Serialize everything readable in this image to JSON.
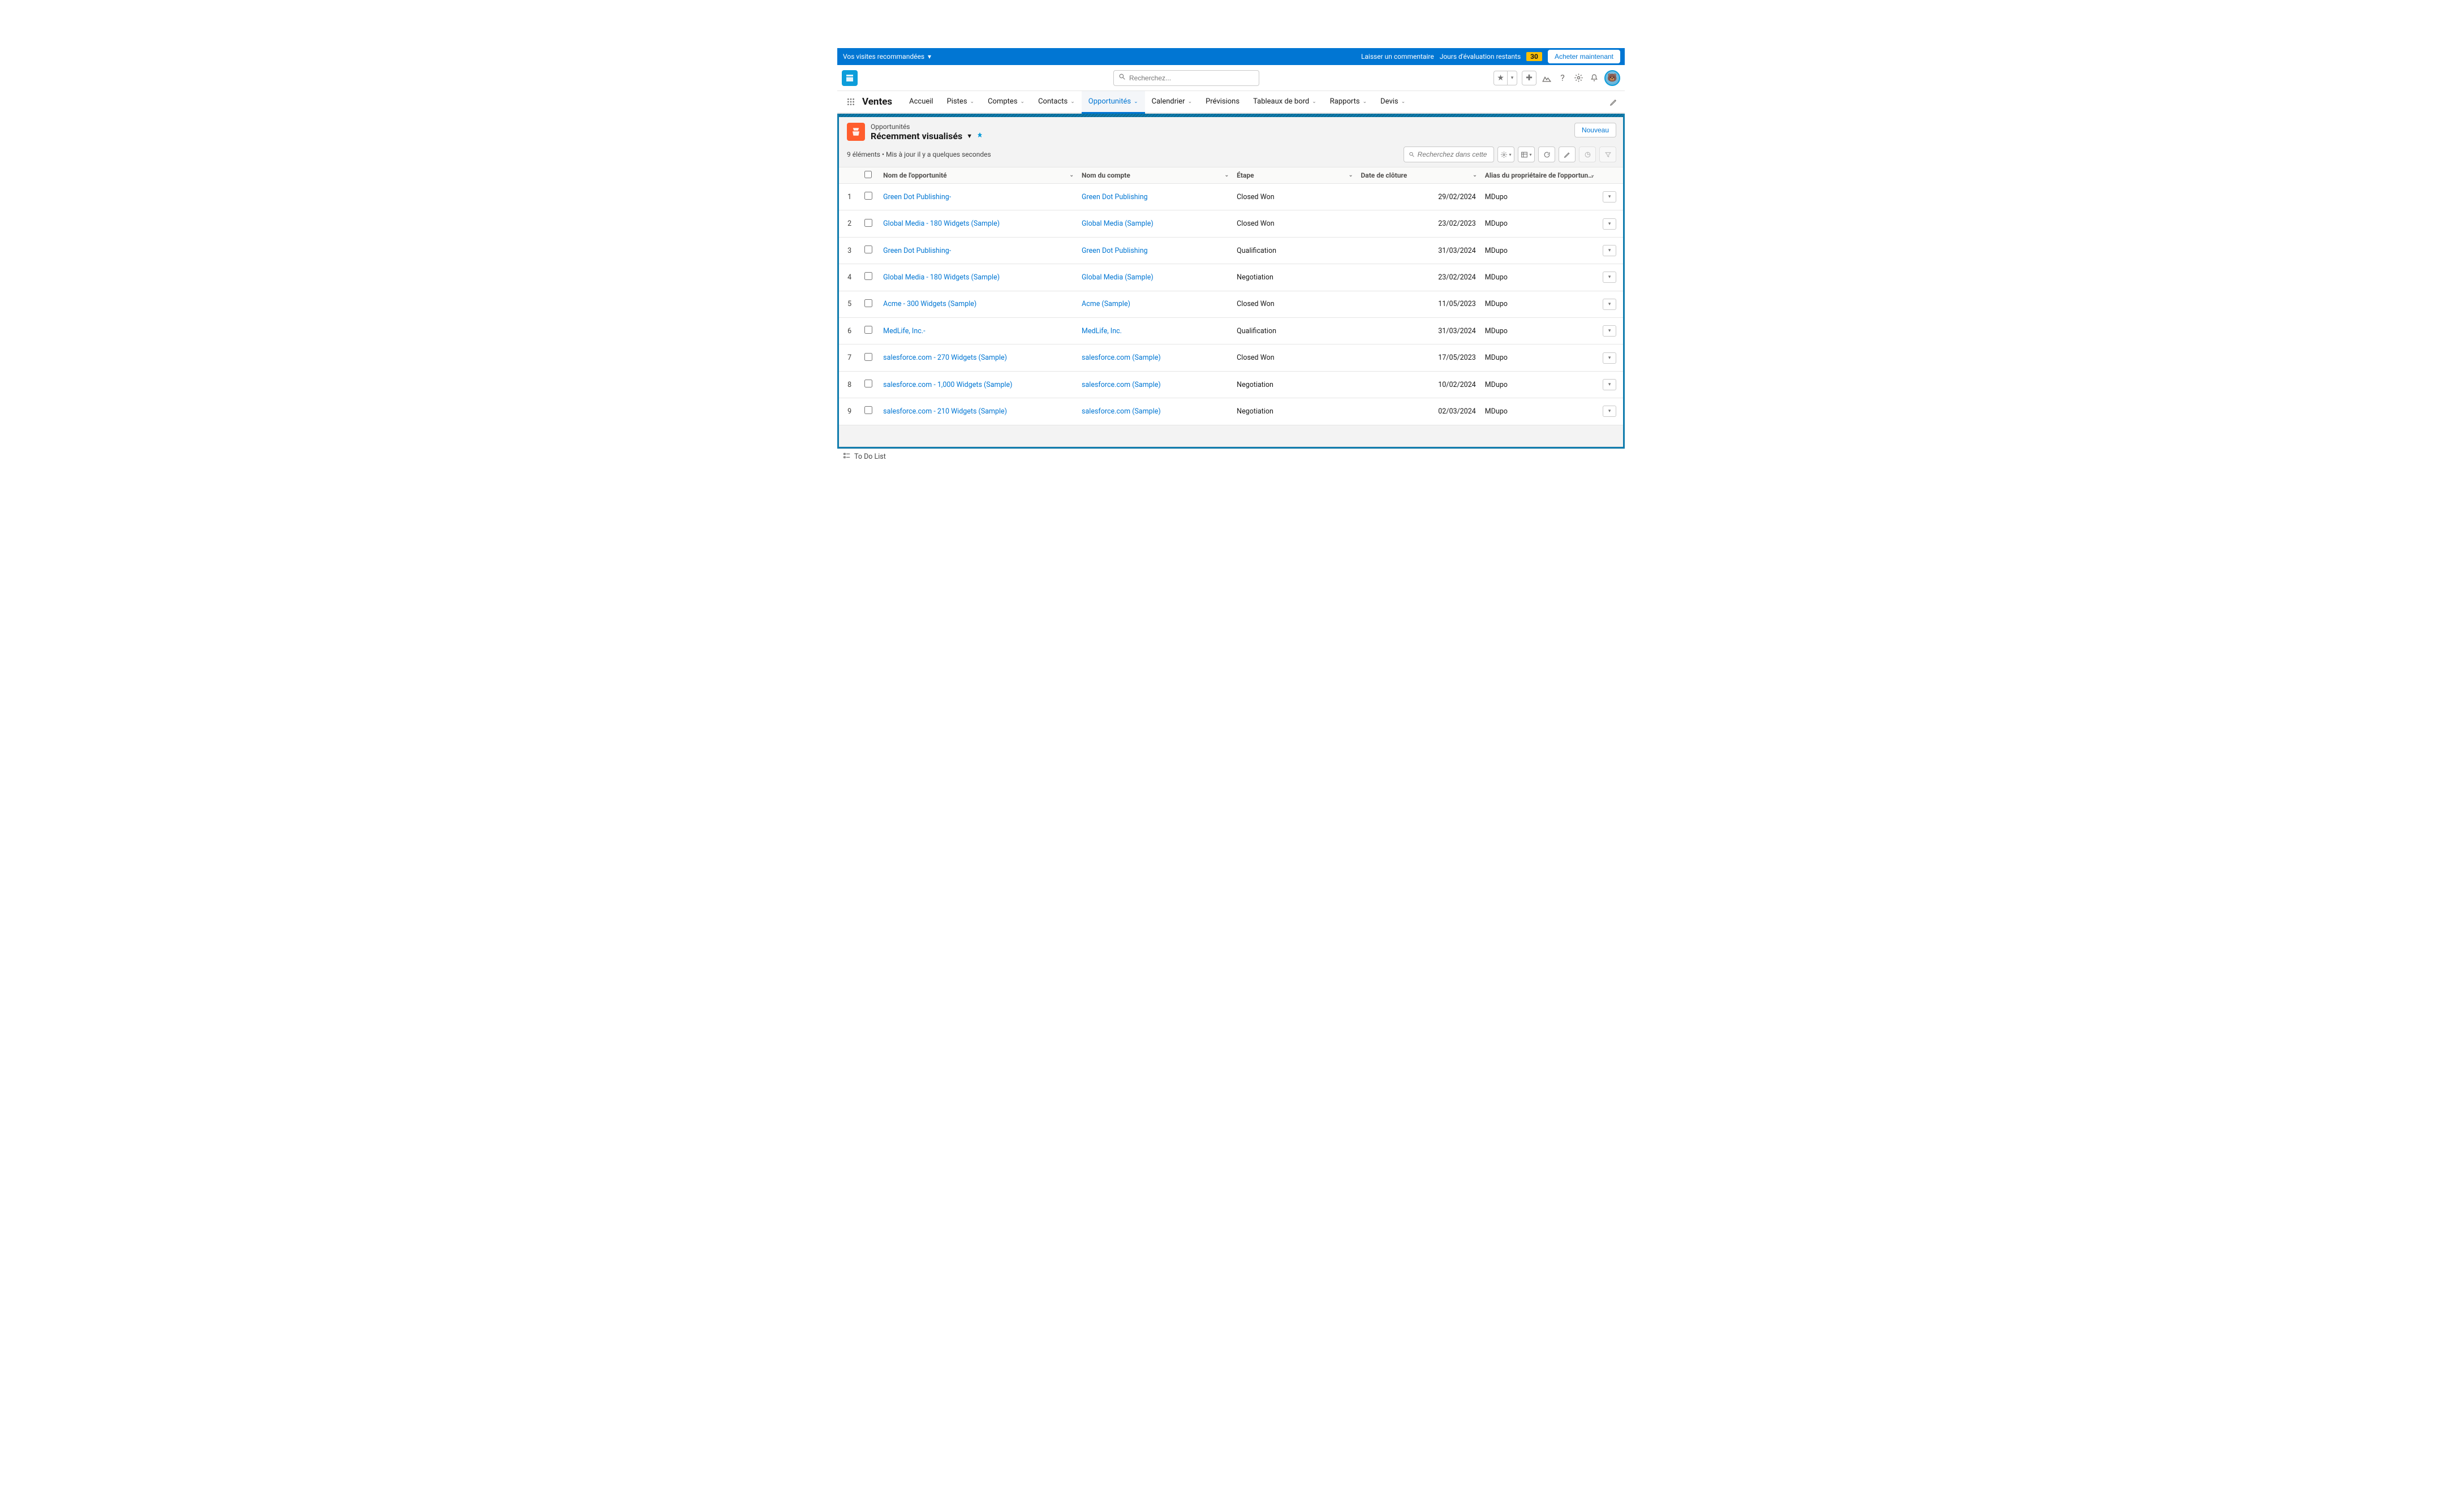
{
  "trial_bar": {
    "visits": "Vos visites recommandées",
    "comment": "Laisser un commentaire",
    "days_label": "Jours d'évaluation restants",
    "days": "30",
    "buy": "Acheter maintenant"
  },
  "global_header": {
    "search_placeholder": "Recherchez..."
  },
  "nav": {
    "app": "Ventes",
    "tabs": [
      {
        "label": "Accueil",
        "dropdown": false
      },
      {
        "label": "Pistes",
        "dropdown": true
      },
      {
        "label": "Comptes",
        "dropdown": true
      },
      {
        "label": "Contacts",
        "dropdown": true
      },
      {
        "label": "Opportunités",
        "dropdown": true,
        "active": true
      },
      {
        "label": "Calendrier",
        "dropdown": true
      },
      {
        "label": "Prévisions",
        "dropdown": false
      },
      {
        "label": "Tableaux de bord",
        "dropdown": true
      },
      {
        "label": "Rapports",
        "dropdown": true
      },
      {
        "label": "Devis",
        "dropdown": true
      }
    ]
  },
  "list_header": {
    "object": "Opportunités",
    "view": "Récemment visualisés",
    "new": "Nouveau",
    "info": "9 éléments • Mis à jour il y a quelques secondes",
    "list_search_placeholder": "Recherchez dans cette liste.."
  },
  "columns": {
    "name": "Nom de l'opportunité",
    "account": "Nom du compte",
    "stage": "Étape",
    "close": "Date de clôture",
    "owner": "Alias du propriétaire de l'opportun…"
  },
  "rows": [
    {
      "n": "1",
      "name": "Green Dot Publishing-",
      "account": "Green Dot Publishing",
      "stage": "Closed Won",
      "close": "29/02/2024",
      "owner": "MDupo"
    },
    {
      "n": "2",
      "name": "Global Media - 180 Widgets (Sample)",
      "account": "Global Media (Sample)",
      "stage": "Closed Won",
      "close": "23/02/2023",
      "owner": "MDupo"
    },
    {
      "n": "3",
      "name": "Green Dot Publishing-",
      "account": "Green Dot Publishing",
      "stage": "Qualification",
      "close": "31/03/2024",
      "owner": "MDupo"
    },
    {
      "n": "4",
      "name": "Global Media - 180 Widgets (Sample)",
      "account": "Global Media (Sample)",
      "stage": "Negotiation",
      "close": "23/02/2024",
      "owner": "MDupo"
    },
    {
      "n": "5",
      "name": "Acme - 300 Widgets (Sample)",
      "account": "Acme (Sample)",
      "stage": "Closed Won",
      "close": "11/05/2023",
      "owner": "MDupo"
    },
    {
      "n": "6",
      "name": "MedLife, Inc.-",
      "account": "MedLife, Inc.",
      "stage": "Qualification",
      "close": "31/03/2024",
      "owner": "MDupo"
    },
    {
      "n": "7",
      "name": "salesforce.com - 270 Widgets (Sample)",
      "account": "salesforce.com (Sample)",
      "stage": "Closed Won",
      "close": "17/05/2023",
      "owner": "MDupo"
    },
    {
      "n": "8",
      "name": "salesforce.com - 1,000 Widgets (Sample)",
      "account": "salesforce.com (Sample)",
      "stage": "Negotiation",
      "close": "10/02/2024",
      "owner": "MDupo"
    },
    {
      "n": "9",
      "name": "salesforce.com - 210 Widgets (Sample)",
      "account": "salesforce.com (Sample)",
      "stage": "Negotiation",
      "close": "02/03/2024",
      "owner": "MDupo"
    }
  ],
  "footer": {
    "todo": "To Do List"
  }
}
